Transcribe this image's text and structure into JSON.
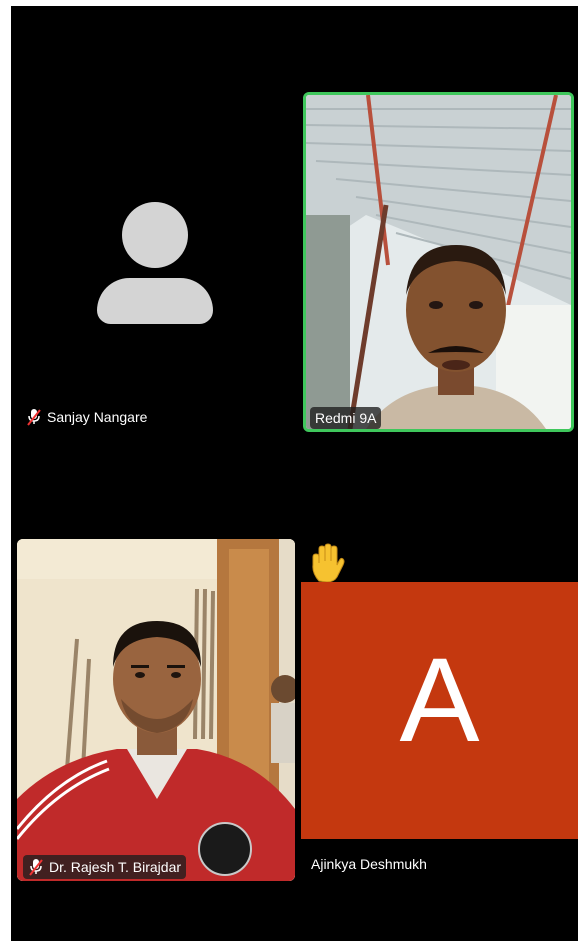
{
  "participants": [
    {
      "name": "Sanjay Nangare",
      "muted": true,
      "video": false
    },
    {
      "name": "Redmi 9A",
      "muted": false,
      "video": true,
      "active_speaker": true
    },
    {
      "name": "Dr. Rajesh T. Birajdar",
      "muted": true,
      "video": true
    },
    {
      "name": "Ajinkya Deshmukh",
      "muted": false,
      "video": false,
      "avatar_letter": "A",
      "avatar_color": "#c4380f",
      "hand_raised": true
    }
  ],
  "colors": {
    "active_speaker_border": "#3fc75c",
    "background": "#000000",
    "avatar_placeholder": "#d4d4d4"
  }
}
